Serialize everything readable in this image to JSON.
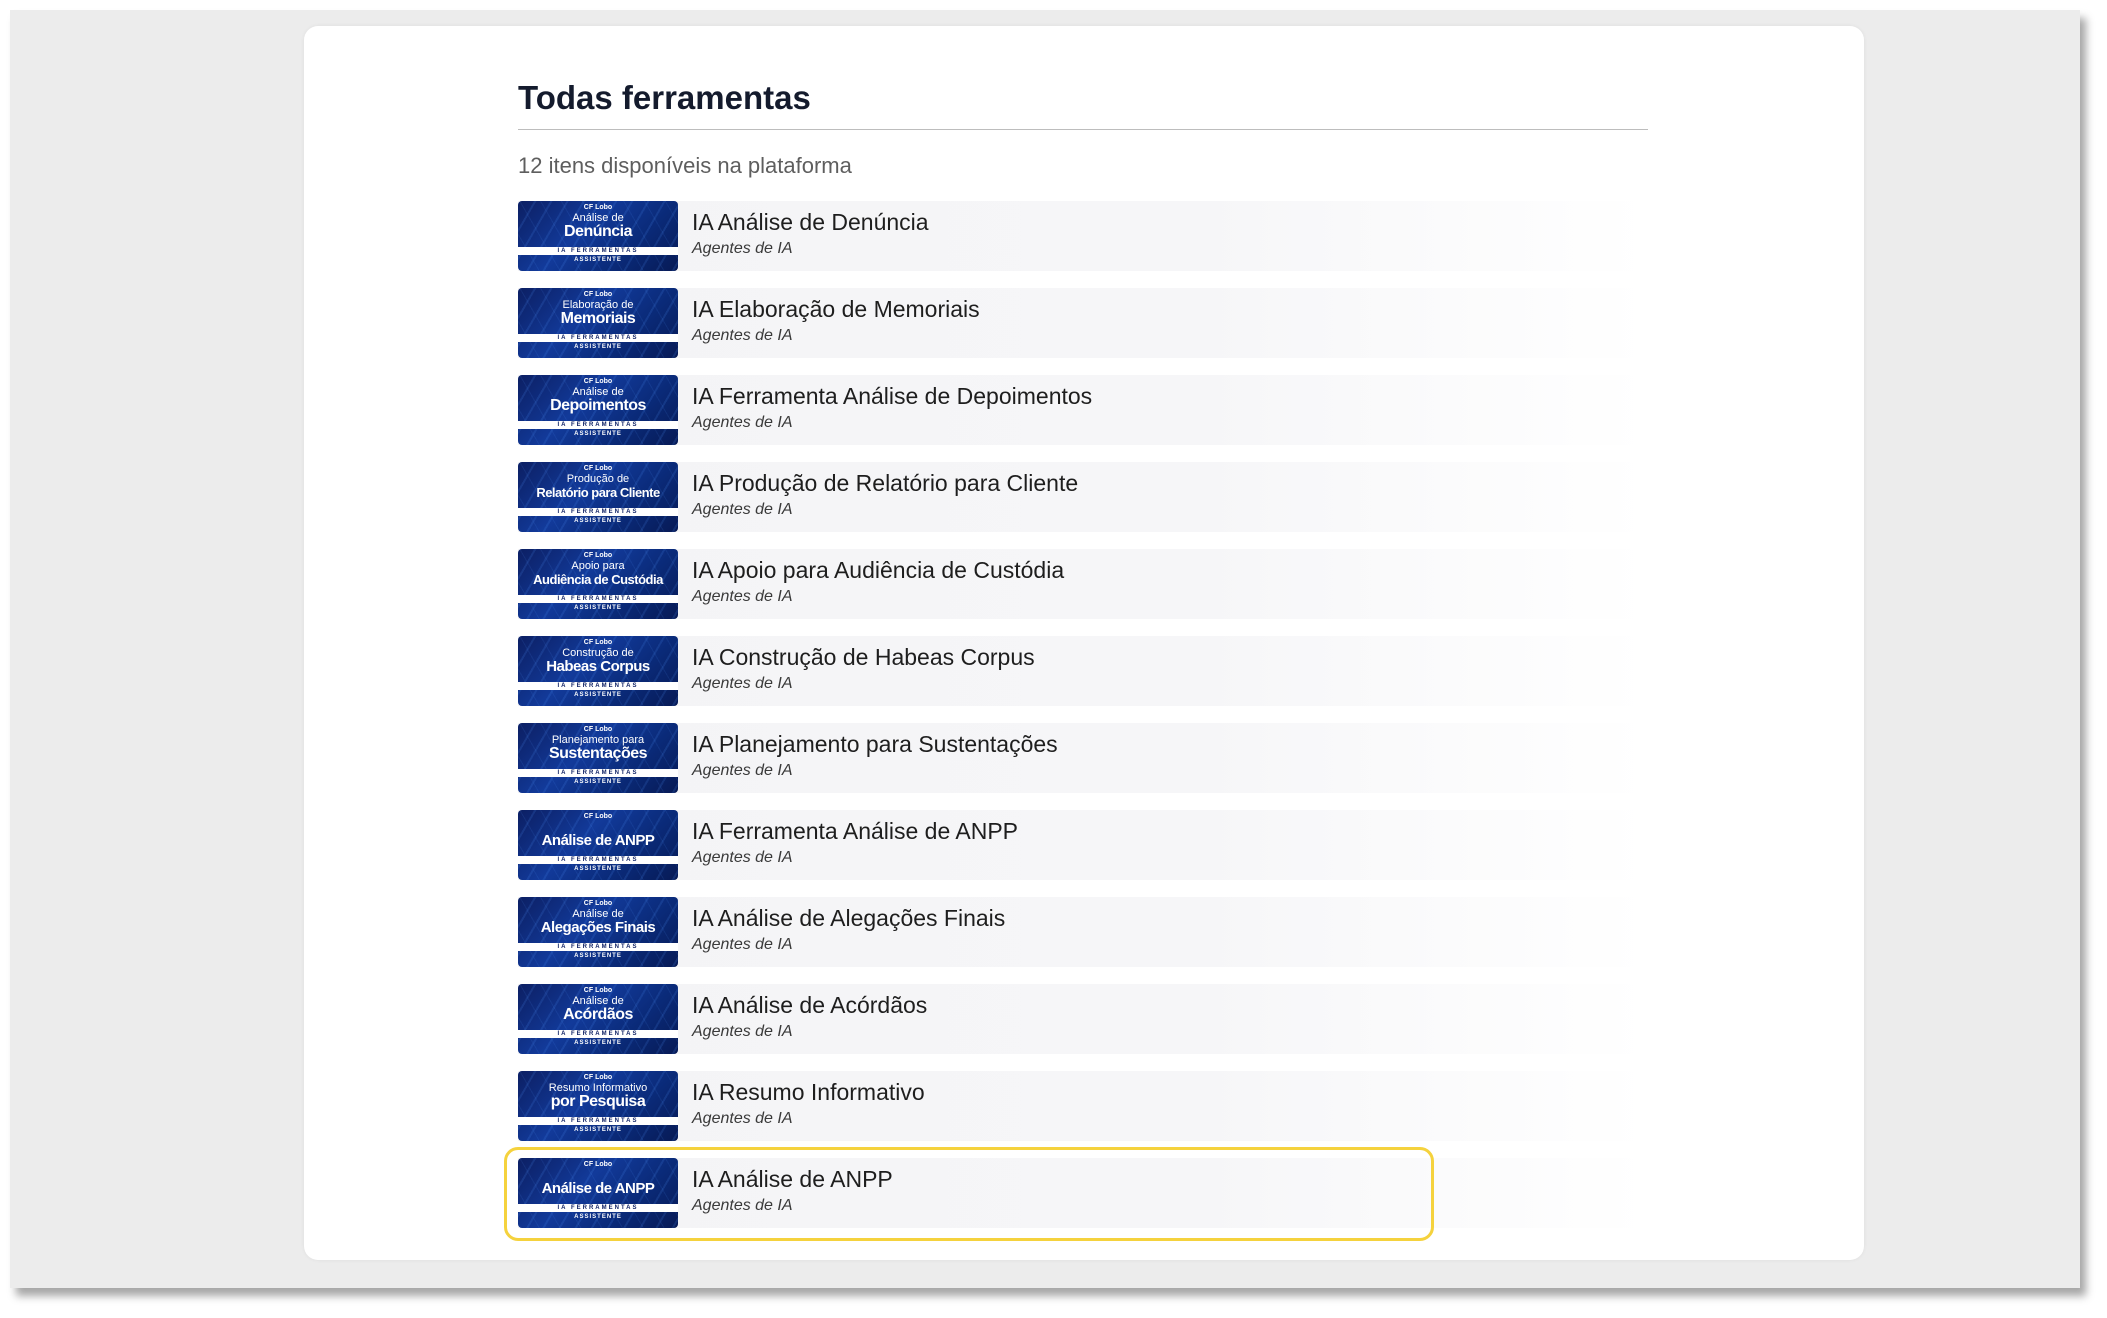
{
  "header": {
    "title": "Todas ferramentas",
    "count_text": "12 itens disponíveis na plataforma"
  },
  "thumbnail_common": {
    "brand": "CF Lobo",
    "band": "IA FERRAMENTAS",
    "sub": "ASSISTENTE"
  },
  "tools": [
    {
      "name": "IA Análise de Denúncia",
      "category": "Agentes de IA",
      "thumb_small": "Análise de",
      "thumb_big": "Denúncia"
    },
    {
      "name": "IA Elaboração de Memoriais",
      "category": "Agentes de IA",
      "thumb_small": "Elaboração de",
      "thumb_big": "Memoriais"
    },
    {
      "name": "IA Ferramenta Análise de Depoimentos",
      "category": "Agentes de IA",
      "thumb_small": "Análise de",
      "thumb_big": "Depoimentos"
    },
    {
      "name": "IA Produção de Relatório para Cliente",
      "category": "Agentes de IA",
      "thumb_small": "Produção de",
      "thumb_big": "Relatório para Cliente"
    },
    {
      "name": "IA Apoio para Audiência de Custódia",
      "category": "Agentes de IA",
      "thumb_small": "Apoio para",
      "thumb_big": "Audiência de Custódia"
    },
    {
      "name": "IA Construção de Habeas Corpus",
      "category": "Agentes de IA",
      "thumb_small": "Construção de",
      "thumb_big": "Habeas Corpus"
    },
    {
      "name": "IA Planejamento para Sustentações",
      "category": "Agentes de IA",
      "thumb_small": "Planejamento para",
      "thumb_big": "Sustentações"
    },
    {
      "name": "IA Ferramenta Análise de ANPP",
      "category": "Agentes de IA",
      "thumb_small": "",
      "thumb_big": "Análise de ANPP"
    },
    {
      "name": "IA Análise de Alegações Finais",
      "category": "Agentes de IA",
      "thumb_small": "Análise de",
      "thumb_big": "Alegações Finais"
    },
    {
      "name": "IA Análise de Acórdãos",
      "category": "Agentes de IA",
      "thumb_small": "Análise de",
      "thumb_big": "Acórdãos"
    },
    {
      "name": "IA Resumo Informativo",
      "category": "Agentes de IA",
      "thumb_small": "Resumo Informativo",
      "thumb_big": "por Pesquisa"
    },
    {
      "name": "IA Análise de ANPP",
      "category": "Agentes de IA",
      "thumb_small": "",
      "thumb_big": "Análise de ANPP",
      "highlighted": true
    }
  ],
  "colors": {
    "highlight_border": "#f5d23d",
    "thumb_blue": "#0c1f63",
    "title_text": "#141b2d"
  }
}
